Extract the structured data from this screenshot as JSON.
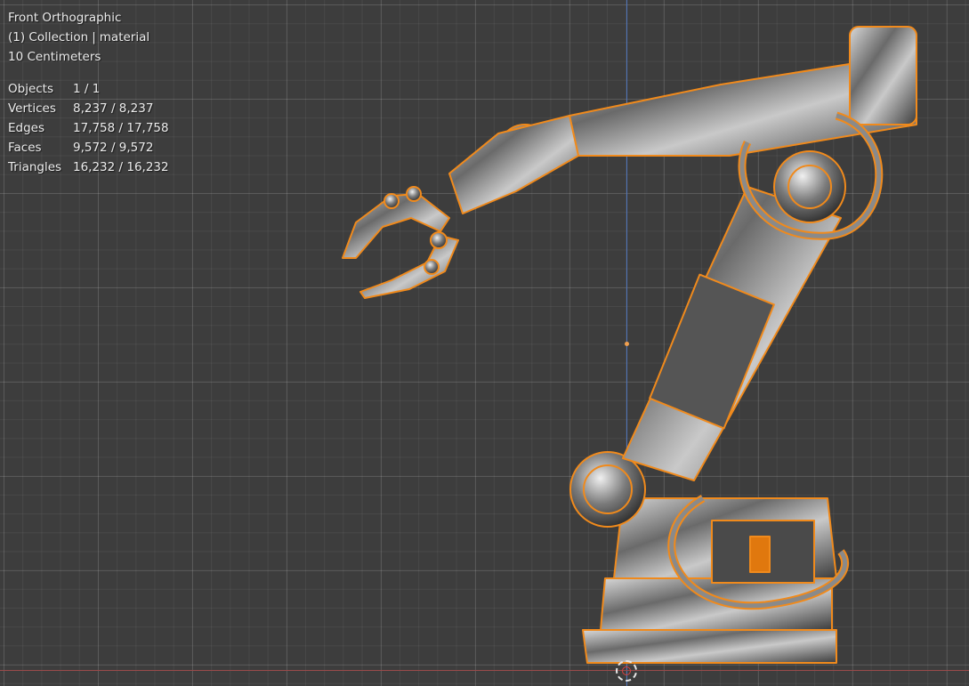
{
  "viewport": {
    "view_name": "Front Orthographic",
    "collection": "(1) Collection",
    "separator": "|",
    "object_name": "material",
    "grid_scale": "10 Centimeters"
  },
  "stats": [
    {
      "label": "Objects",
      "value": "1 / 1"
    },
    {
      "label": "Vertices",
      "value": "8,237 / 8,237"
    },
    {
      "label": "Edges",
      "value": "17,758 / 17,758"
    },
    {
      "label": "Faces",
      "value": "9,572 / 9,572"
    },
    {
      "label": "Triangles",
      "value": "16,232 / 16,232"
    }
  ],
  "colors": {
    "background": "#3d3d3d",
    "selection_outline": "#f08a1c",
    "axis_z": "#4f73b8",
    "axis_x": "#9a4a4a"
  }
}
